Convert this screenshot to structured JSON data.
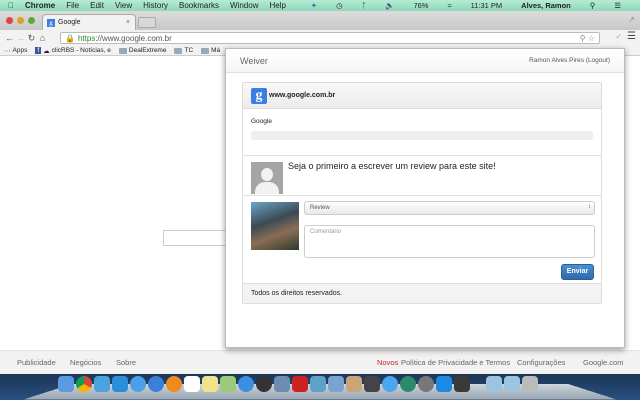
{
  "menubar": {
    "app": "Chrome",
    "items": [
      "File",
      "Edit",
      "View",
      "History",
      "Bookmarks",
      "Window",
      "Help"
    ],
    "battery": "76%",
    "time": "11:31 PM",
    "user": "Alves, Ramon"
  },
  "tab": {
    "title": "Google",
    "favicon": "g"
  },
  "address": {
    "scheme": "https",
    "rest": "://www.google.com.br"
  },
  "bookmarks": [
    {
      "label": "Apps",
      "icon": "apps-grid-icon"
    },
    {
      "label": "clicRBS - Notícias, e",
      "icon": "cloud-icon"
    },
    {
      "label": "DealExtreme",
      "icon": "folder-icon"
    },
    {
      "label": "TC",
      "icon": "folder-icon"
    },
    {
      "label": "Má",
      "icon": "folder-icon"
    }
  ],
  "popup": {
    "brand": "Weiver",
    "user": "Ramon Alves Pires (Logout)",
    "site": "www.google.com.br",
    "site_icon": "g",
    "site_name": "Google",
    "empty_message": "Seja o primeiro a escrever um review para este site!",
    "select_value": "Review",
    "comment_placeholder": "Comentário",
    "submit": "Enviar",
    "footer": "Todos os direitos reservados."
  },
  "footer": {
    "left": [
      "Publicidade",
      "Negócios",
      "Sobre"
    ],
    "new_badge": "Novos",
    "privacy": "Política de Privacidade e Termos",
    "settings": "Configurações",
    "site": "Google.com",
    "new_color": "#c5232c"
  }
}
